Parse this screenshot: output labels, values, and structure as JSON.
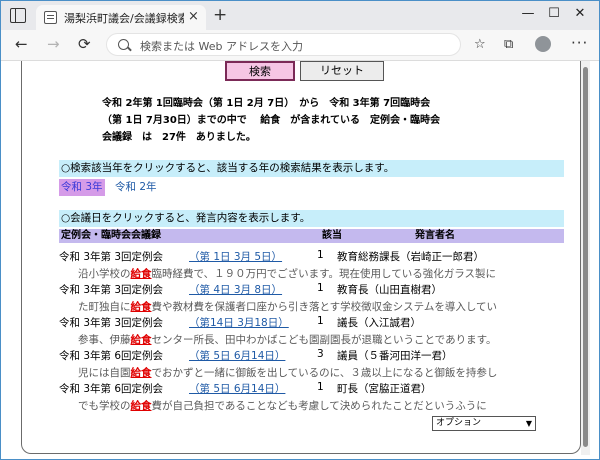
{
  "browser": {
    "tab_title": "湯梨浜町議会/会議録検索システム",
    "close_glyph": "×",
    "newtab_glyph": "+",
    "address_placeholder": "検索または Web アドレスを入力",
    "window_buttons": [
      "—",
      "☐",
      "✕"
    ],
    "back_glyph": "←",
    "forward_glyph": "→",
    "refresh_glyph": "⟳",
    "favorite_glyph": "☆",
    "collections_glyph": "⧉",
    "menu_glyph": "···"
  },
  "buttons": {
    "search": "検索",
    "reset": "リセット"
  },
  "summary": {
    "line1": "令和 2年第 1回臨時会（第 1日 2月 7日）　から　令和 3年第 7回臨時会",
    "line2": "（第 1日 7月30日）までの中で　 給食　が含まれている　定例会・臨時会",
    "line3": "会議録　は　27件　ありました。"
  },
  "year_section": {
    "instruction": "○検索該当年をクリックすると、該当する年の検索結果を表示します。",
    "years": [
      "令和 3年",
      "令和 2年"
    ]
  },
  "day_section": {
    "instruction": "○会議日をクリックすると、発言内容を表示します。",
    "headers": {
      "meeting": "定例会・臨時会会議録",
      "applicable": "該当",
      "speaker": "発言者名"
    }
  },
  "keyword": "給食",
  "entries": [
    {
      "meeting": "令和 3年第 3回定例会",
      "date": "（第 1日 3月 5日）",
      "count": "1",
      "speaker": "教育総務課長（岩崎正一郎君）",
      "snippet_pre": "沿小学校の",
      "snippet_post": "臨時経費で、１９０万円でございます。現在使用している強化ガラス製に"
    },
    {
      "meeting": "令和 3年第 3回定例会",
      "date": "（第 4日 3月 8日）",
      "count": "1",
      "speaker": "教育長（山田直樹君）",
      "snippet_pre": "た町独自に",
      "snippet_post": "費や教材費を保護者口座から引き落とす学校徴収金システムを導入してい"
    },
    {
      "meeting": "令和 3年第 3回定例会",
      "date": "（第14日 3月18日）",
      "count": "1",
      "speaker": "議長（入江誠君）",
      "snippet_pre": "参事、伊藤",
      "snippet_post": "センター所長、田中わかばこども園副園長が退職ということであります。"
    },
    {
      "meeting": "令和 3年第 6回定例会",
      "date": "（第 5日 6月14日）",
      "count": "3",
      "speaker": "議員（５番河田洋一君）",
      "snippet_pre": "児には自園",
      "snippet_post": "でおかずと一緒に御飯を出しているのに、３歳以上になると御飯を持参し"
    },
    {
      "meeting": "令和 3年第 6回定例会",
      "date": "（第 5日 6月14日）",
      "count": "1",
      "speaker": "町長（宮脇正道君）",
      "snippet_pre": "でも学校の",
      "snippet_post": "費が自己負担であることなども考慮して決められたことだというふうに"
    }
  ],
  "option_select": {
    "selected": "オプション"
  }
}
